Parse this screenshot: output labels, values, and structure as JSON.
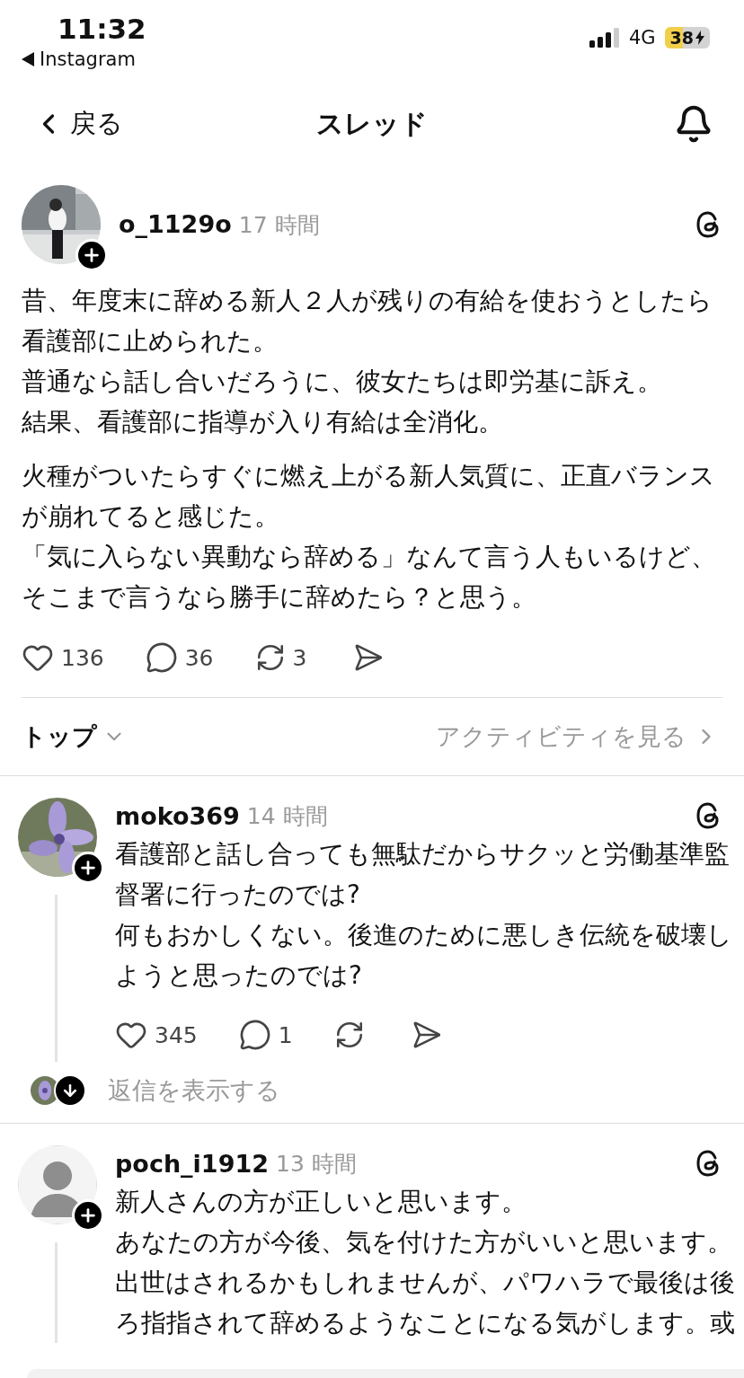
{
  "status_bar": {
    "time": "11:32",
    "back_app": "Instagram",
    "network": "4G",
    "battery": "38"
  },
  "nav": {
    "back_label": "戻る",
    "title": "スレッド"
  },
  "post": {
    "username": "o_1129o",
    "time": "17 時間",
    "photo": true,
    "paragraphs": [
      [
        "昔、年度末に辞める新人２人が残りの有給を使おうとしたら看護部に止められた。",
        "普通なら話し合いだろうに、彼女たちは即労基に訴え。",
        "結果、看護部に指導が入り有給は全消化。"
      ],
      [
        "火種がついたらすぐに燃え上がる新人気質に、正直バランスが崩れてると感じた。",
        "「気に入らない異動なら辞める」なんて言う人もいるけど、そこまで言うなら勝手に辞めたら？と思う。"
      ]
    ],
    "likes": "136",
    "comments": "36",
    "reposts": "3"
  },
  "sort": {
    "label": "トップ",
    "activity": "アクティビティを見る"
  },
  "replies": [
    {
      "username": "moko369",
      "time": "14 時間",
      "photo": true,
      "lines": [
        "看護部と話し合っても無駄だからサクッと労働基準監督署に行ったのでは?",
        "何もおかしくない。後進のために悪しき伝統を破壊しようと思ったのでは?"
      ],
      "likes": "345",
      "comments": "1",
      "show_replies": "返信を表示する"
    },
    {
      "username": "poch_i1912",
      "time": "13 時間",
      "photo": false,
      "lines": [
        "新人さんの方が正しいと思います。",
        "あなたの方が今後、気を付けた方がいいと思います。出世はされるかもしれませんが、パワハラで最後は後ろ指指されて辞めるようなことになる気がします。或"
      ]
    }
  ]
}
